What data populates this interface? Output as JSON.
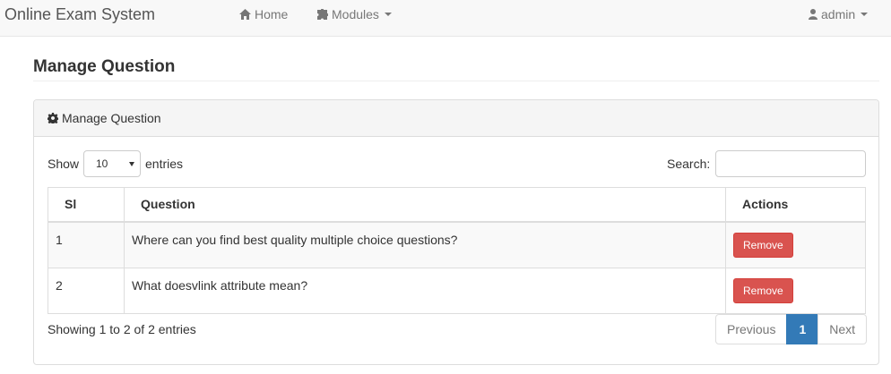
{
  "navbar": {
    "brand": "Online Exam System",
    "home_label": "Home",
    "home_icon": "home-icon",
    "modules_label": "Modules",
    "modules_icon": "puzzle-icon",
    "user_label": "admin",
    "user_icon": "user-icon"
  },
  "page": {
    "title": "Manage Question"
  },
  "panel": {
    "heading": "Manage Question",
    "heading_icon": "gear-icon"
  },
  "table_controls": {
    "show_label": "Show",
    "length_value": "10",
    "entries_label": "entries",
    "search_label": "Search:",
    "search_value": "",
    "search_placeholder": ""
  },
  "table": {
    "columns": [
      "Sl",
      "Question",
      "Actions"
    ],
    "rows": [
      {
        "sl": "1",
        "question": "Where can you find best quality multiple choice questions?",
        "action": "Remove"
      },
      {
        "sl": "2",
        "question": "What doesvlink attribute mean?",
        "action": "Remove"
      }
    ]
  },
  "footer": {
    "info": "Showing 1 to 2 of 2 entries",
    "pagination": {
      "previous": "Previous",
      "current": "1",
      "next": "Next"
    }
  },
  "colors": {
    "remove_button": "#d9534f",
    "active_page": "#337ab7",
    "navbar_bg": "#f8f8f8"
  }
}
